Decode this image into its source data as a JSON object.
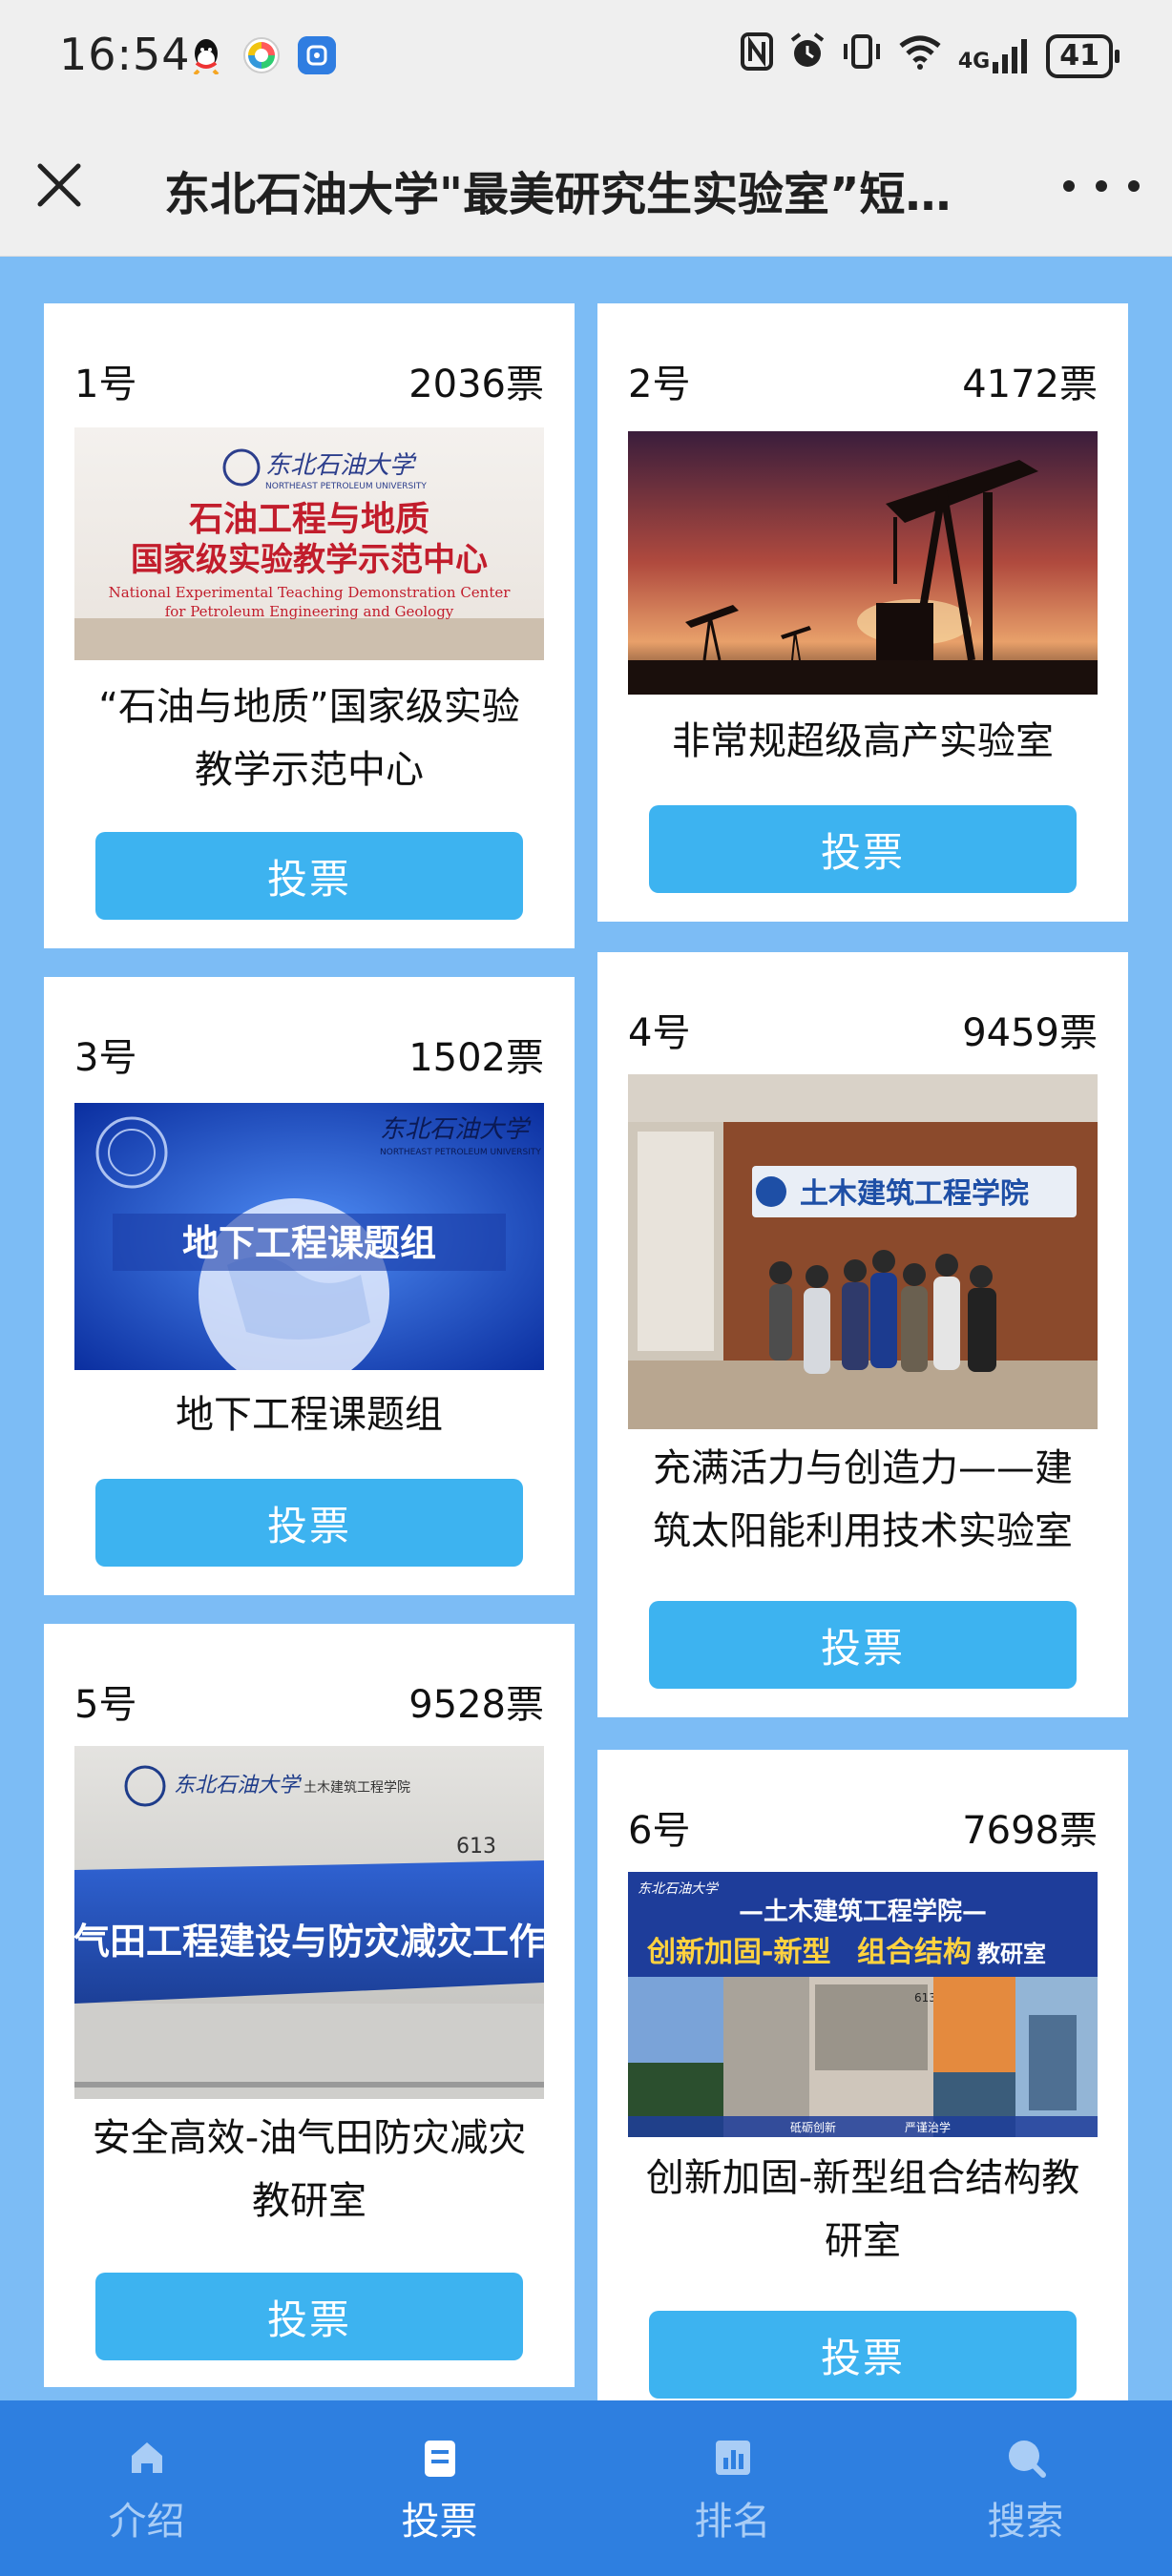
{
  "status_bar": {
    "time": "16:54",
    "network": "4G",
    "battery": "41",
    "icons": [
      "qq-icon",
      "app-icon",
      "app-icon",
      "nfc-icon",
      "alarm-icon",
      "vibrate-icon",
      "wifi-icon",
      "signal-icon",
      "battery-icon"
    ]
  },
  "header": {
    "title": "东北石油大学\"最美研究生实验室”短…",
    "close_icon": "close-icon",
    "more_icon": "more-icon"
  },
  "cards": [
    {
      "no": "1号",
      "votes": "2036票",
      "name_lines": [
        "“石油与地质”国家级实验",
        "教学示范中心"
      ],
      "vote_label": "投票",
      "image": {
        "logo": "东北石油大学",
        "logo_en": "NORTHEAST PETROLEUM UNIVERSITY",
        "line1": "石油工程与地质",
        "line2": "国家级实验教学示范中心",
        "en1": "National Experimental Teaching Demonstration Center",
        "en2": "for Petroleum Engineering and Geology"
      }
    },
    {
      "no": "2号",
      "votes": "4172票",
      "name_lines": [
        "非常规超级高产实验室"
      ],
      "vote_label": "投票"
    },
    {
      "no": "3号",
      "votes": "1502票",
      "name_lines": [
        "地下工程课题组"
      ],
      "vote_label": "投票",
      "image": {
        "logo": "东北石油大学",
        "logo_en": "NORTHEAST PETROLEUM UNIVERSITY",
        "banner": "地下工程课题组"
      }
    },
    {
      "no": "4号",
      "votes": "9459票",
      "name_lines": [
        "充满活力与创造力——建",
        "筑太阳能利用技术实验室"
      ],
      "vote_label": "投票",
      "image": {
        "sign": "土木建筑工程学院"
      }
    },
    {
      "no": "5号",
      "votes": "9528票",
      "name_lines": [
        "安全高效-油气田防灾减灾",
        "教研室"
      ],
      "vote_label": "投票",
      "image": {
        "logo": "东北石油大学",
        "dept": "土木建筑工程学院",
        "room": "613",
        "plate": "油气田工程建设与防灾减灾工作室"
      }
    },
    {
      "no": "6号",
      "votes": "7698票",
      "name_lines": [
        "创新加固-新型组合结构教",
        "研室"
      ],
      "vote_label": "投票",
      "image": {
        "logo": "东北石油大学",
        "line1": "—土木建筑工程学院—",
        "line2a": "创新加固-新型",
        "line2b": "组合结构",
        "line2c": "教研室",
        "caption1": "砥砺创新",
        "caption2": "严谨治学",
        "room": "613"
      }
    }
  ],
  "tabbar": {
    "tabs": [
      {
        "label": "介绍",
        "icon": "home-icon"
      },
      {
        "label": "投票",
        "icon": "vote-icon",
        "active": true
      },
      {
        "label": "排名",
        "icon": "ranking-icon"
      },
      {
        "label": "搜索",
        "icon": "search-icon"
      }
    ]
  }
}
